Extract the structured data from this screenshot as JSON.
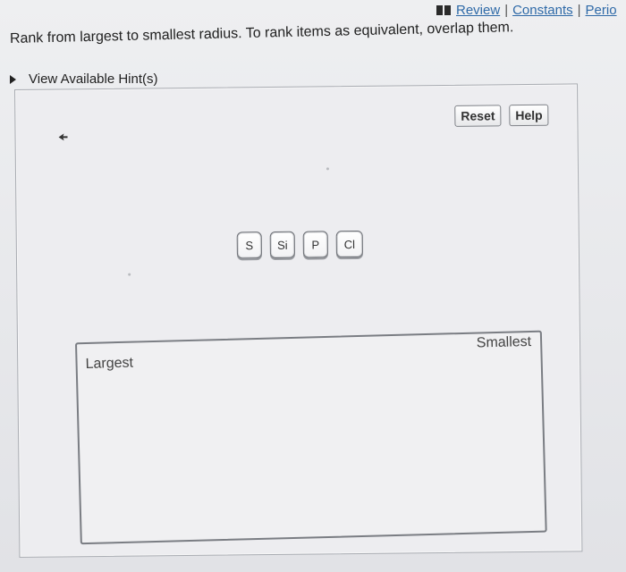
{
  "toplinks": {
    "review": "Review",
    "constants": "Constants",
    "periodic": "Perio",
    "separator": "|"
  },
  "prompt": "Rank from largest to smallest radius. To rank items as equivalent, overlap them.",
  "hints_label": "View Available Hint(s)",
  "buttons": {
    "reset": "Reset",
    "help": "Help"
  },
  "tiles": [
    "S",
    "Si",
    "P",
    "Cl"
  ],
  "dropzone": {
    "largest": "Largest",
    "smallest": "Smallest"
  },
  "icons": {
    "book": "book-icon",
    "hint_toggle": "triangle-right-icon"
  },
  "colors": {
    "link": "#2f6aa8",
    "background": "#e6e7ea"
  }
}
